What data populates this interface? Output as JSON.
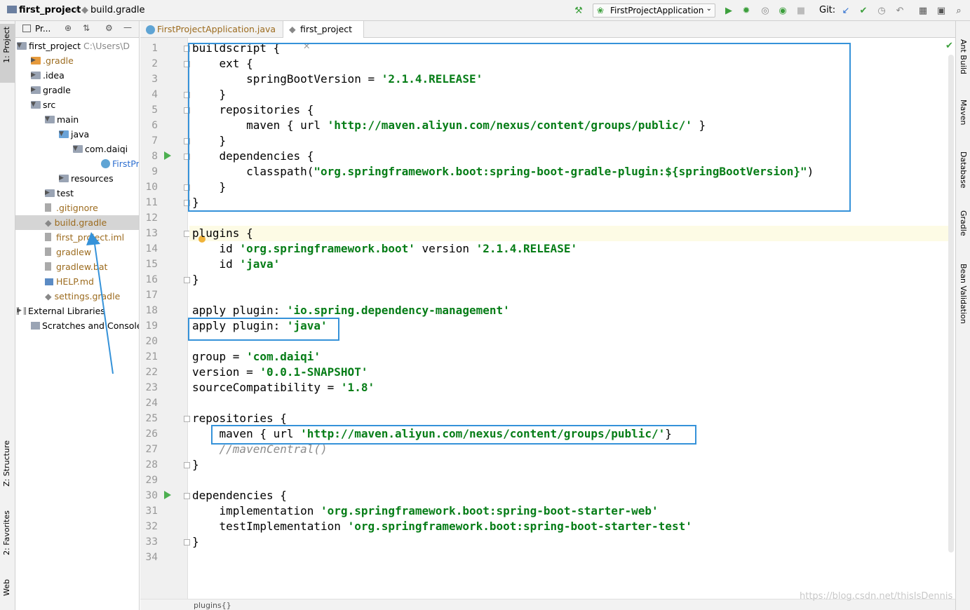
{
  "breadcrumb": {
    "project": "first_project",
    "file": "build.gradle"
  },
  "toolbar": {
    "run_config": "FirstProjectApplication",
    "git_label": "Git:"
  },
  "left_tabs": {
    "project": "1: Project",
    "structure": "Z: Structure",
    "favorites": "2: Favorites",
    "web": "Web"
  },
  "right_tabs": {
    "ant": "Ant Build",
    "maven": "Maven",
    "database": "Database",
    "gradle": "Gradle",
    "bean": "Bean Validation"
  },
  "project_panel": {
    "title": "Pr...",
    "items": [
      {
        "label": "first_project",
        "extra": "C:\\Users\\D"
      },
      {
        "label": ".gradle"
      },
      {
        "label": ".idea"
      },
      {
        "label": "gradle"
      },
      {
        "label": "src"
      },
      {
        "label": "main"
      },
      {
        "label": "java"
      },
      {
        "label": "com.daiqi"
      },
      {
        "label": "FirstPr"
      },
      {
        "label": "resources"
      },
      {
        "label": "test"
      },
      {
        "label": ".gitignore"
      },
      {
        "label": "build.gradle"
      },
      {
        "label": "first_project.iml"
      },
      {
        "label": "gradlew"
      },
      {
        "label": "gradlew.bat"
      },
      {
        "label": "HELP.md"
      },
      {
        "label": "settings.gradle"
      },
      {
        "label": "External Libraries"
      },
      {
        "label": "Scratches and Consoles"
      }
    ]
  },
  "editor_tabs": [
    {
      "label": "FirstProjectApplication.java"
    },
    {
      "label": "first_project"
    }
  ],
  "code_lines": [
    "buildscript {",
    "    ext {",
    "        springBootVersion = '2.1.4.RELEASE'",
    "    }",
    "    repositories {",
    "        maven { url 'http://maven.aliyun.com/nexus/content/groups/public/' }",
    "    }",
    "    dependencies {",
    "        classpath(\"org.springframework.boot:spring-boot-gradle-plugin:${springBootVersion}\")",
    "    }",
    "}",
    "",
    "plugins {",
    "    id 'org.springframework.boot' version '2.1.4.RELEASE'",
    "    id 'java'",
    "}",
    "",
    "apply plugin: 'io.spring.dependency-management'",
    "apply plugin: 'java'",
    "",
    "group = 'com.daiqi'",
    "version = '0.0.1-SNAPSHOT'",
    "sourceCompatibility = '1.8'",
    "",
    "repositories {",
    "    maven { url 'http://maven.aliyun.com/nexus/content/groups/public/'}",
    "    //mavenCentral()",
    "}",
    "",
    "dependencies {",
    "    implementation 'org.springframework.boot:spring-boot-starter-web'",
    "    testImplementation 'org.springframework.boot:spring-boot-starter-test'",
    "}",
    ""
  ],
  "status": {
    "breadcrumb": "plugins{}"
  },
  "watermark": "https://blog.csdn.net/thisIsDennis"
}
